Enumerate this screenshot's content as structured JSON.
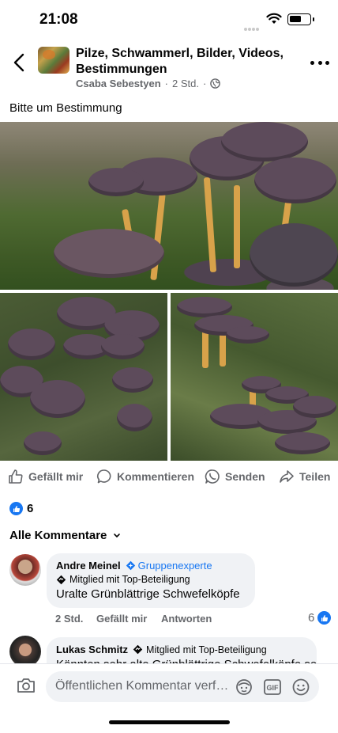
{
  "status_bar": {
    "time": "21:08"
  },
  "header": {
    "group_title": "Pilze, Schwammerl, Bilder, Videos, Bestimmungen",
    "author": "Csaba Sebestyen",
    "separator": "·",
    "time_ago": "2 Std.",
    "audience_icon": "globe-icon"
  },
  "post": {
    "text": "Bitte um Bestimmung"
  },
  "actions": {
    "like": "Gefällt mir",
    "comment": "Kommentieren",
    "send": "Senden",
    "share": "Teilen"
  },
  "reactions": {
    "count": "6"
  },
  "comments_filter": {
    "label": "Alle Kommentare"
  },
  "comments": [
    {
      "name": "Andre Meinel",
      "role": "Gruppenexperte",
      "badge": "Mitglied mit Top-Beteiligung",
      "text": "Uralte Grünblättrige Schwefelköpfe",
      "time": "2 Std.",
      "like_label": "Gefällt mir",
      "reply_label": "Antworten",
      "likes": "6"
    },
    {
      "name": "Lukas Schmitz",
      "badge": "Mitglied mit Top-Beteiligung",
      "text": "Könnten sehr alte Grünblättrige Schwefelköpfe sein"
    }
  ],
  "composer": {
    "placeholder": "Öffentlichen Kommentar verfassen…"
  },
  "colors": {
    "accent": "#1877f2",
    "secondary_text": "#65676b",
    "bubble": "#f0f2f5"
  }
}
